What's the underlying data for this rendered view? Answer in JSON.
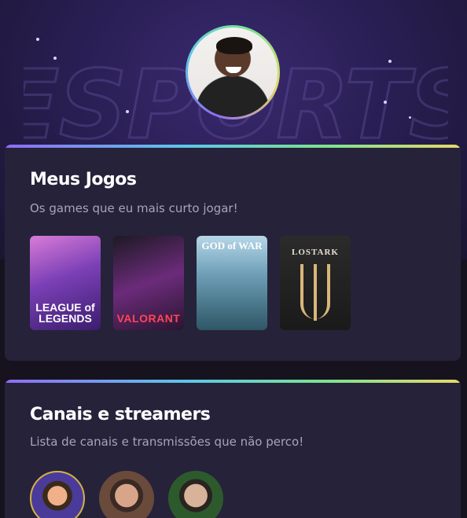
{
  "header": {
    "avatar_icon": "profile-avatar",
    "background_logo_text": "ESPORTS"
  },
  "games_section": {
    "title": "Meus Jogos",
    "subtitle": "Os games que eu mais curto jogar!",
    "games": [
      {
        "label": "LEAGUE of LEGENDS"
      },
      {
        "label": "VALORANT"
      },
      {
        "label": "GOD of WAR"
      },
      {
        "label": "LOSTARK"
      }
    ]
  },
  "streamers_section": {
    "title": "Canais e streamers",
    "subtitle": "Lista de canais e transmissões que não perco!",
    "streamers": [
      {
        "icon": "streamer-avatar"
      },
      {
        "icon": "streamer-avatar"
      },
      {
        "icon": "streamer-avatar"
      }
    ]
  },
  "colors": {
    "card_bg": "#26223a",
    "accent_gradient": [
      "#8f6cf5",
      "#5cc7e8",
      "#7be38f",
      "#e6d86a"
    ],
    "hero_bg": "#2a1f55"
  }
}
